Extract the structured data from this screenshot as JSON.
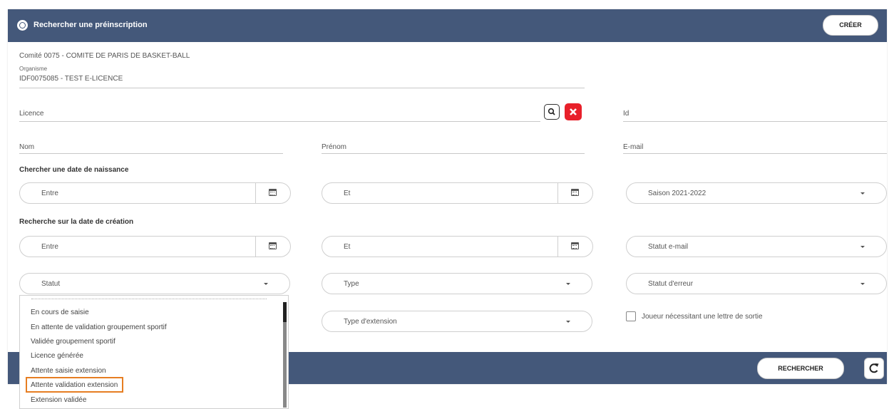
{
  "header": {
    "title": "Rechercher une préinscription",
    "create_label": "CRÉER"
  },
  "info": {
    "comite": "Comité  0075 - COMITE DE PARIS DE BASKET-BALL",
    "organisme_label": "Organisme",
    "organisme_value": "IDF0075085 - TEST E-LICENCE"
  },
  "fields": {
    "licence": "Licence",
    "id": "Id",
    "nom": "Nom",
    "prenom": "Prénom",
    "email": "E-mail"
  },
  "birth_section": {
    "title": "Chercher une date de naissance",
    "entre": "Entre",
    "et": "Et",
    "saison": "Saison 2021-2022"
  },
  "creation_section": {
    "title": "Recherche sur la date de création",
    "entre": "Entre",
    "et": "Et",
    "statut_email": "Statut e-mail"
  },
  "filters": {
    "statut": "Statut",
    "type": "Type",
    "statut_erreur": "Statut d'erreur",
    "type_extension": "Type d'extension",
    "joueur_lettre": "Joueur nécessitant une lettre de sortie"
  },
  "dropdown": {
    "items": [
      "En cours de saisie",
      "En attente de validation groupement sportif",
      "Validée groupement sportif",
      "Licence générée",
      "Attente saisie extension",
      "Attente validation extension",
      "Extension validée"
    ]
  },
  "actions": {
    "rechercher_label": "RECHERCHER"
  },
  "colors": {
    "header_bg": "#44587a",
    "highlight": "#e67e22",
    "clear_button": "#e8202a"
  }
}
